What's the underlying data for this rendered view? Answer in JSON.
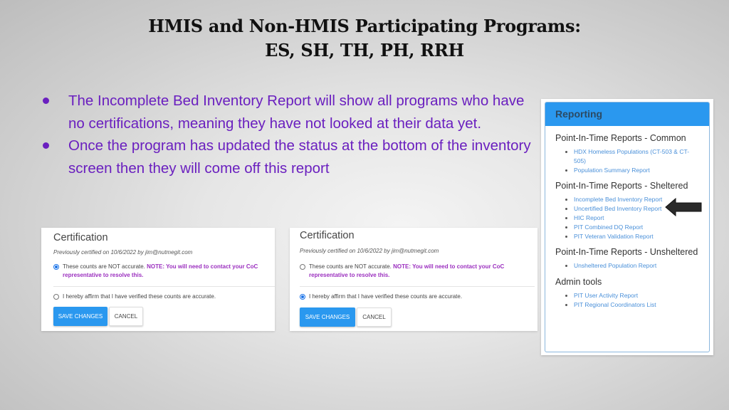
{
  "slide": {
    "title_line1": "HMIS and Non-HMIS Participating Programs:",
    "title_line2": "ES, SH, TH, PH, RRH",
    "bullets": [
      "The Incomplete Bed Inventory Report will show all programs who have no certifications, meaning they have not looked at their data yet.",
      "Once the program has updated the status at the bottom of the inventory screen then they will come off this report"
    ],
    "colors": {
      "bullet_text": "#6a1fbf",
      "primary_button": "#2a98ef",
      "note_text": "#9b2fbf",
      "link": "#4a90d9"
    }
  },
  "certification_panels": [
    {
      "title": "Certification",
      "previously_certified": "Previously certified on 10/6/2022 by jim@nutmegit.com",
      "option_not_accurate": "These counts are NOT accurate.",
      "note": "NOTE: You will need to contact your CoC representative to resolve this.",
      "option_affirm": "I hereby affirm that I have verified these counts are accurate.",
      "selected": "not_accurate",
      "save_label": "SAVE CHANGES",
      "cancel_label": "CANCEL"
    },
    {
      "title": "Certification",
      "previously_certified": "Previously certified on 10/6/2022 by jim@nutmegit.com",
      "option_not_accurate": "These counts are NOT accurate.",
      "note": "NOTE: You will need to contact your CoC representative to resolve this.",
      "option_affirm": "I hereby affirm that I have verified these counts are accurate.",
      "selected": "affirm",
      "save_label": "SAVE CHANGES",
      "cancel_label": "CANCEL"
    }
  ],
  "reporting": {
    "header": "Reporting",
    "sections": [
      {
        "title": "Point-In-Time Reports - Common",
        "links": [
          "HDX Homeless Populations (CT-503 & CT-505)",
          "Population Summary Report"
        ]
      },
      {
        "title": "Point-In-Time Reports - Sheltered",
        "links": [
          "Incomplete Bed Inventory Report",
          "Uncertified Bed Inventory Report",
          "HIC Report",
          "PIT Combined DQ Report",
          "PIT Veteran Validation Report"
        ]
      },
      {
        "title": "Point-In-Time Reports - Unsheltered",
        "links": [
          "Unsheltered Population Report"
        ]
      },
      {
        "title": "Admin tools",
        "links": [
          "PIT User Activity Report",
          "PIT Regional Coordinators List"
        ]
      }
    ],
    "highlighted_link": "Incomplete Bed Inventory Report"
  }
}
